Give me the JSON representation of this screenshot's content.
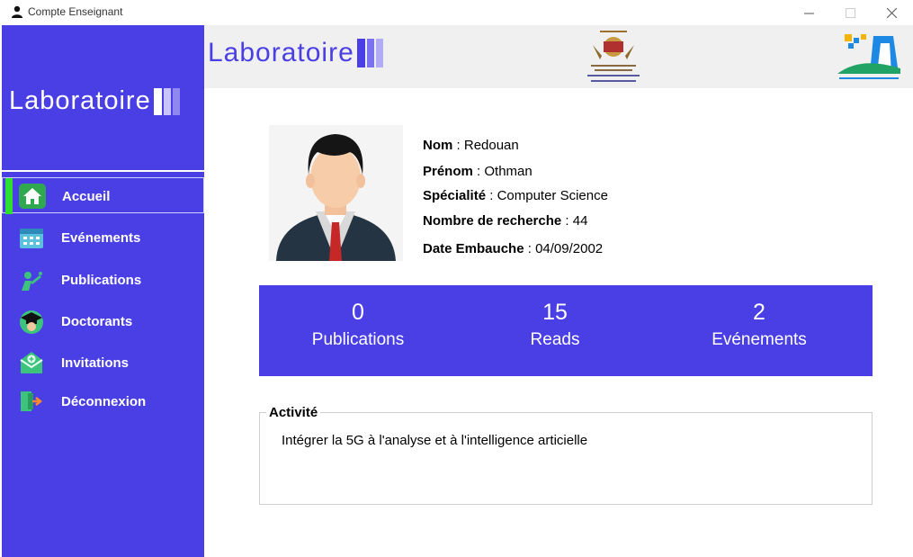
{
  "window": {
    "title": "Compte Enseignant"
  },
  "brand": {
    "name": "Laboratoire",
    "bar_colors": [
      "#ffffff",
      "#c8c4ff",
      "#8f88f0"
    ],
    "head_bar_colors": [
      "#4a3fe4",
      "#7b72f0",
      "#b2acf7"
    ]
  },
  "colors": {
    "accent": "#4a3fe4",
    "active_indicator": "#2ee02e"
  },
  "sidebar": {
    "items": [
      {
        "label": "Accueil",
        "icon": "home-icon",
        "active": true
      },
      {
        "label": "Evénements",
        "icon": "calendar-icon",
        "active": false
      },
      {
        "label": "Publications",
        "icon": "publication-icon",
        "active": false
      },
      {
        "label": "Doctorants",
        "icon": "graduate-icon",
        "active": false
      },
      {
        "label": "Invitations",
        "icon": "envelope-icon",
        "active": false
      },
      {
        "label": "Déconnexion",
        "icon": "logout-icon",
        "active": false
      }
    ]
  },
  "profile": {
    "nom_label": "Nom",
    "nom": "Redouan",
    "prenom_label": "Prénom",
    "prenom": "Othman",
    "specialite_label": "Spécialité",
    "specialite": "Computer Science",
    "recherche_label": "Nombre de recherche",
    "recherche": "44",
    "embauche_label": "Date Embauche",
    "embauche": "04/09/2002"
  },
  "stats": [
    {
      "value": "0",
      "label": "Publications"
    },
    {
      "value": "15",
      "label": "Reads"
    },
    {
      "value": "2",
      "label": "Evénements"
    }
  ],
  "activity": {
    "title": "Activité",
    "text": "Intégrer la 5G à l'analyse et à l'intelligence articielle"
  }
}
